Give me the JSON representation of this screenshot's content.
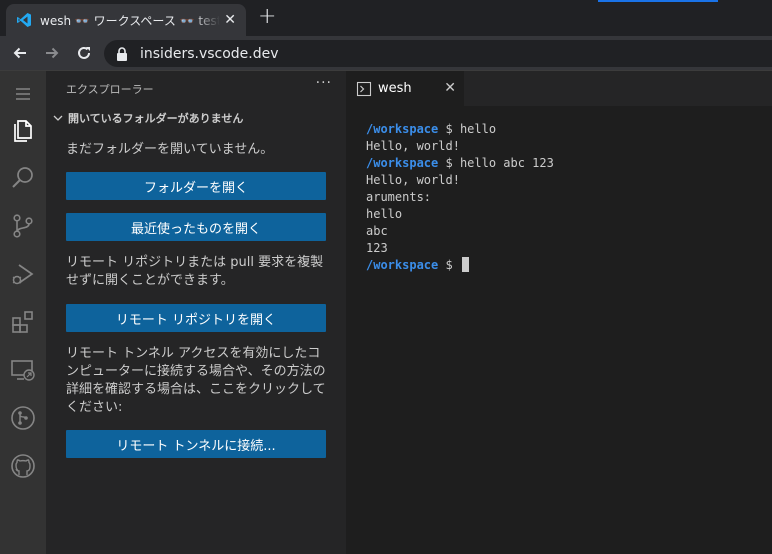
{
  "browser": {
    "tab_title": "wesh 👓 ワークスペース 👓 test-vscode",
    "tab_close": "✕",
    "new_tab": "+",
    "url": "insiders.vscode.dev"
  },
  "activity_bar": {
    "items": [
      "menu-icon",
      "files-icon",
      "search-icon",
      "source-control-icon",
      "run-debug-icon",
      "extensions-icon",
      "remote-explorer-icon",
      "git-pull-request-icon",
      "github-icon"
    ]
  },
  "sidebar": {
    "header": "エクスプローラー",
    "more": "···",
    "section_title": "開いているフォルダーがありません",
    "no_folder_msg": "まだフォルダーを開いていません。",
    "open_folder_btn": "フォルダーを開く",
    "open_recent_btn": "最近使ったものを開く",
    "remote_repo_msg": "リモート リポジトリまたは pull 要求を複製せずに開くことができます。",
    "open_remote_repo_btn": "リモート リポジトリを開く",
    "remote_tunnel_msg": "リモート トンネル アクセスを有効にしたコンピューターに接続する場合や、その方法の詳細を確認する場合は、ここをクリックしてください:",
    "connect_tunnel_btn": "リモート トンネルに接続..."
  },
  "editor": {
    "tab_label": "wesh",
    "tab_close": "✕"
  },
  "terminal": {
    "prompt_path": "/workspace",
    "prompt_symbol": " $ ",
    "lines": [
      {
        "cmd": "hello"
      },
      {
        "out": "Hello, world!"
      },
      {
        "cmd": "hello abc 123"
      },
      {
        "out": "Hello, world!"
      },
      {
        "out": "aruments:"
      },
      {
        "out": "hello"
      },
      {
        "out": "abc"
      },
      {
        "out": "123"
      }
    ]
  },
  "colors": {
    "accent_button": "#0e639c",
    "prompt_path": "#3b8eea",
    "vscode_logo": "#23a9f2"
  }
}
